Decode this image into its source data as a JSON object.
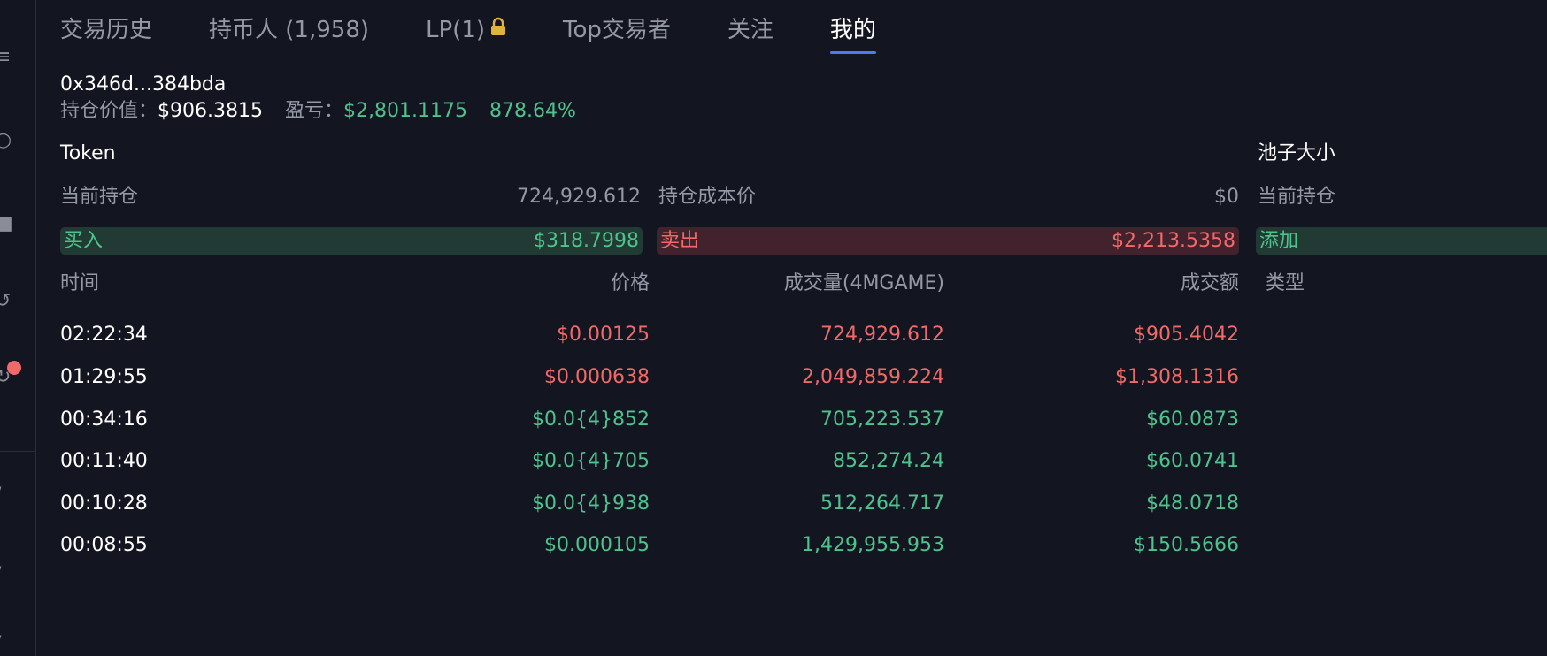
{
  "tabs": [
    {
      "label": "交易历史",
      "active": false
    },
    {
      "label": "持币人 (1,958)",
      "active": false
    },
    {
      "label": "LP(1)",
      "active": false,
      "icon": "lock-icon"
    },
    {
      "label": "Top交易者",
      "active": false
    },
    {
      "label": "关注",
      "active": false
    },
    {
      "label": "我的",
      "active": true
    }
  ],
  "wallet": {
    "address": "0x346d...384bda",
    "position_value_label": "持仓价值：",
    "position_value": "$906.3815",
    "pnl_label": "盈亏：",
    "pnl_value": "$2,801.1175",
    "pnl_percent": "878.64%"
  },
  "token_section": {
    "title": "Token",
    "current_holding_label": "当前持仓",
    "current_holding_value": "724,929.612",
    "cost_label": "持仓成本价",
    "cost_value": "$0",
    "buy_label": "买入",
    "buy_value": "$318.7998",
    "sell_label": "卖出",
    "sell_value": "$2,213.5358"
  },
  "pool_section": {
    "title": "池子大小",
    "current_holding_label": "当前持仓",
    "add_label": "添加"
  },
  "trades_table": {
    "headers": {
      "time": "时间",
      "price": "价格",
      "volume": "成交量(4MGAME)",
      "amount": "成交额",
      "type": "类型"
    },
    "rows": [
      {
        "time": "02:22:34",
        "price": "$0.00125",
        "volume": "724,929.612",
        "amount": "$905.4042",
        "side": "sell"
      },
      {
        "time": "01:29:55",
        "price": "$0.000638",
        "volume": "2,049,859.224",
        "amount": "$1,308.1316",
        "side": "sell"
      },
      {
        "time": "00:34:16",
        "price": "$0.0{4}852",
        "volume": "705,223.537",
        "amount": "$60.0873",
        "side": "buy"
      },
      {
        "time": "00:11:40",
        "price": "$0.0{4}705",
        "volume": "852,274.24",
        "amount": "$60.0741",
        "side": "buy"
      },
      {
        "time": "00:10:28",
        "price": "$0.0{4}938",
        "volume": "512,264.717",
        "amount": "$48.0718",
        "side": "buy"
      },
      {
        "time": "00:08:55",
        "price": "$0.000105",
        "volume": "1,429,955.953",
        "amount": "$150.5666",
        "side": "buy"
      }
    ]
  },
  "colors": {
    "background": "#131520",
    "accent": "#4c7cf3",
    "buy_green": "#4fc38c",
    "sell_red": "#f06a6a",
    "muted_text": "#9599a6",
    "lock_gold": "#e2b33c"
  }
}
